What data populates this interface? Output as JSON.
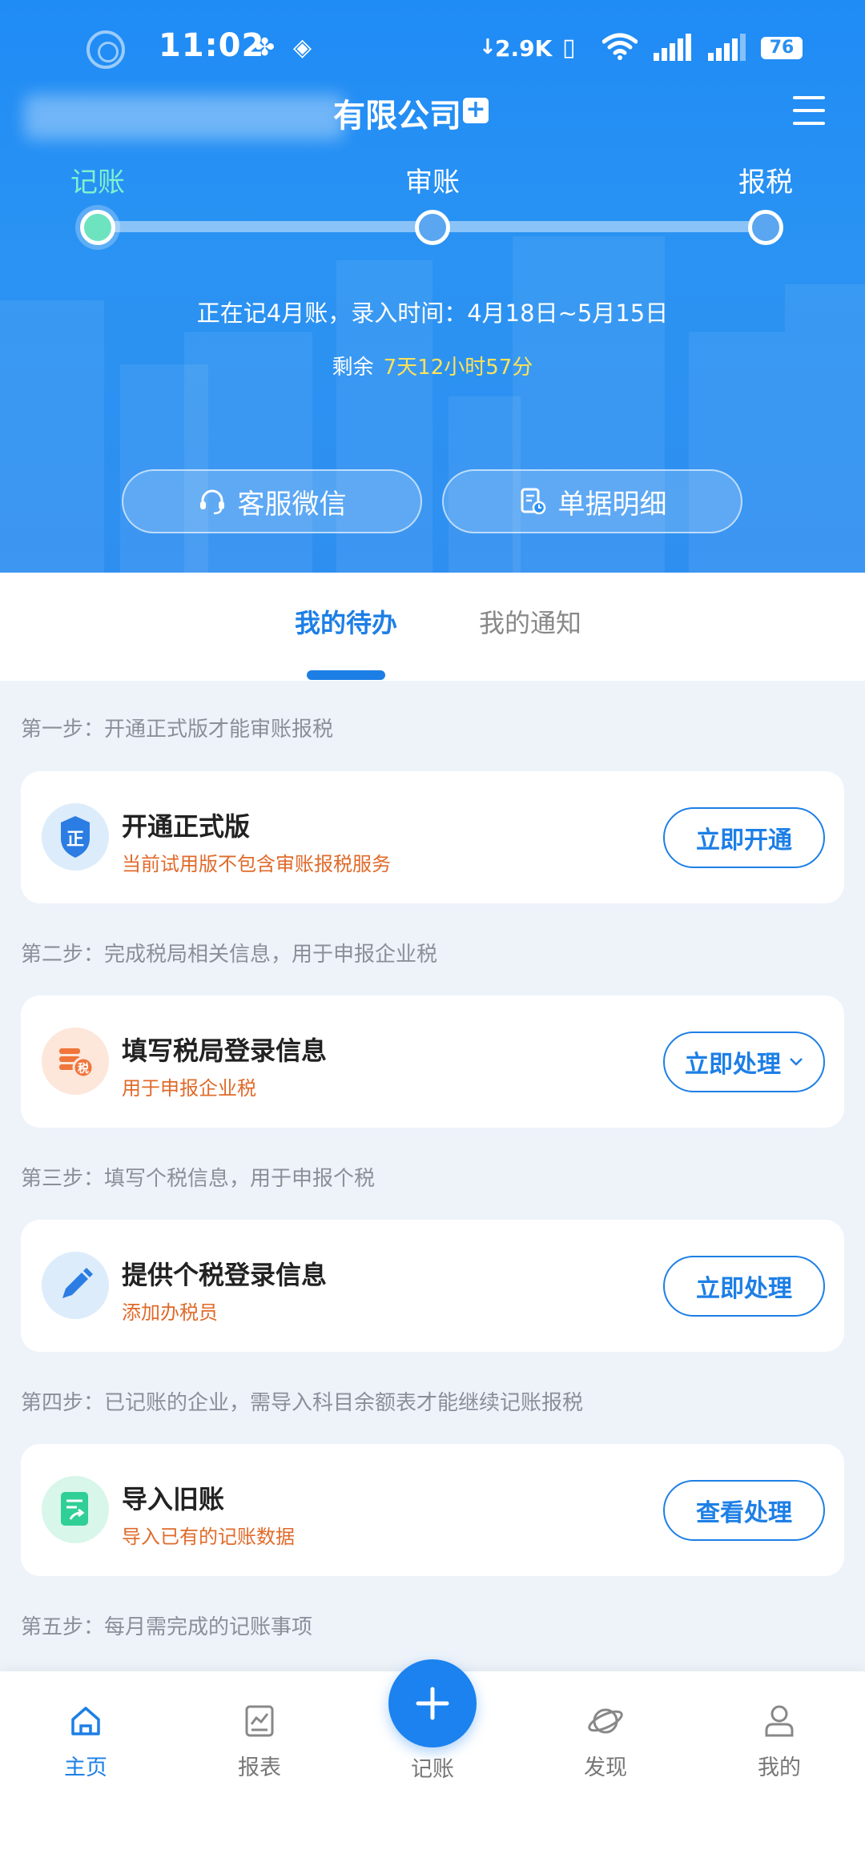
{
  "status_bar": {
    "time": "11:02",
    "net_speed": "2.9K",
    "battery": "76"
  },
  "header": {
    "company_name": "有限公司",
    "add_icon": "plus-square-icon",
    "menu_icon": "menu-icon",
    "steps": [
      {
        "label": "记账",
        "active": true
      },
      {
        "label": "审账",
        "active": false
      },
      {
        "label": "报税",
        "active": false
      }
    ],
    "period_info": "正在记4月账，录入时间：4月18日~5月15日",
    "remaining_label": "剩余",
    "remaining_time": "7天12小时57分",
    "buttons": [
      {
        "label": "客服微信",
        "icon": "headset-icon"
      },
      {
        "label": "单据明细",
        "icon": "receipt-icon"
      }
    ]
  },
  "tabs": [
    {
      "label": "我的待办",
      "active": true
    },
    {
      "label": "我的通知",
      "active": false
    }
  ],
  "tasks": [
    {
      "step": "第一步：开通正式版才能审账报税",
      "title": "开通正式版",
      "subtitle": "当前试用版不包含审账报税服务",
      "button": "立即开通",
      "icon": "badge-icon",
      "icon_label": "正"
    },
    {
      "step": "第二步：完成税局相关信息，用于申报企业税",
      "title": "填写税局登录信息",
      "subtitle": "用于申报企业税",
      "button": "立即处理",
      "has_chevron": true,
      "icon": "tax-coins-icon",
      "icon_label": "税"
    },
    {
      "step": "第三步：填写个税信息，用于申报个税",
      "title": "提供个税登录信息",
      "subtitle": "添加办税员",
      "button": "立即处理",
      "icon": "pencil-icon"
    },
    {
      "step": "第四步：已记账的企业，需导入科目余额表才能继续记账报税",
      "title": "导入旧账",
      "subtitle": "导入已有的记账数据",
      "button": "查看处理",
      "icon": "import-doc-icon"
    }
  ],
  "step5_title": "第五步：每月需完成的记账事项",
  "bottom_nav": [
    {
      "label": "主页",
      "icon": "home-icon",
      "active": true
    },
    {
      "label": "报表",
      "icon": "report-icon",
      "active": false
    },
    {
      "label": "记账",
      "icon": "plus-icon",
      "active": false
    },
    {
      "label": "发现",
      "icon": "planet-icon",
      "active": false
    },
    {
      "label": "我的",
      "icon": "user-icon",
      "active": false
    }
  ],
  "colors": {
    "primary": "#1d7fe6",
    "header_blue": "#2a8ff0",
    "active_step": "#6ee3c0",
    "highlight": "#ffe25a",
    "subtitle_orange": "#e06a2a"
  }
}
